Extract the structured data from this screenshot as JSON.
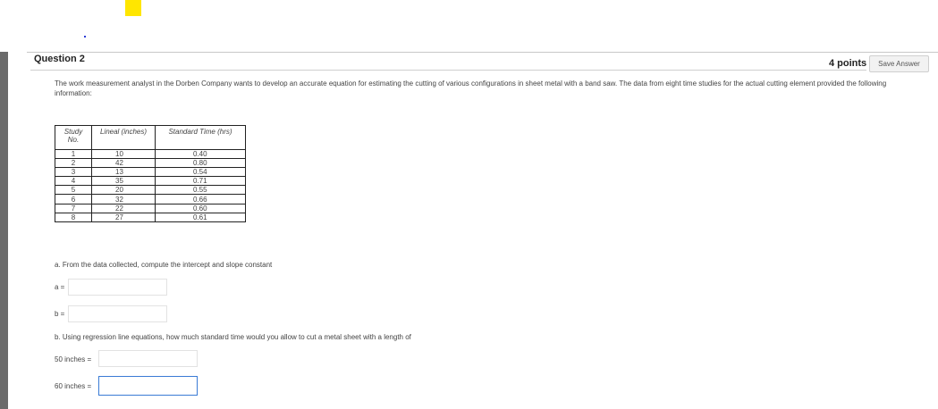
{
  "question": {
    "title": "Question 2",
    "points": "4 points",
    "save_label": "Save Answer",
    "prompt": "The work measurement analyst in the Dorben Company wants to develop an accurate equation for estimating the cutting of various configurations in sheet metal with a band saw. The data from eight time studies for the actual cutting element provided the following information:"
  },
  "table": {
    "headers": [
      "Study No.",
      "Lineal (inches)",
      "Standard Time (hrs)"
    ],
    "rows": [
      [
        "1",
        "10",
        "0.40"
      ],
      [
        "2",
        "42",
        "0.80"
      ],
      [
        "3",
        "13",
        "0.54"
      ],
      [
        "4",
        "35",
        "0.71"
      ],
      [
        "5",
        "20",
        "0.55"
      ],
      [
        "6",
        "32",
        "0.66"
      ],
      [
        "7",
        "22",
        "0.60"
      ],
      [
        "8",
        "27",
        "0.61"
      ]
    ]
  },
  "part_a": {
    "text": "a. From the data collected, compute the intercept and slope constant",
    "a_label": "a =",
    "b_label": "b ="
  },
  "part_b": {
    "text": "b. Using regression line equations, how much standard time would you allow to cut a metal sheet with a length of",
    "label_50": "50 inches =",
    "label_60": "60 inches ="
  }
}
